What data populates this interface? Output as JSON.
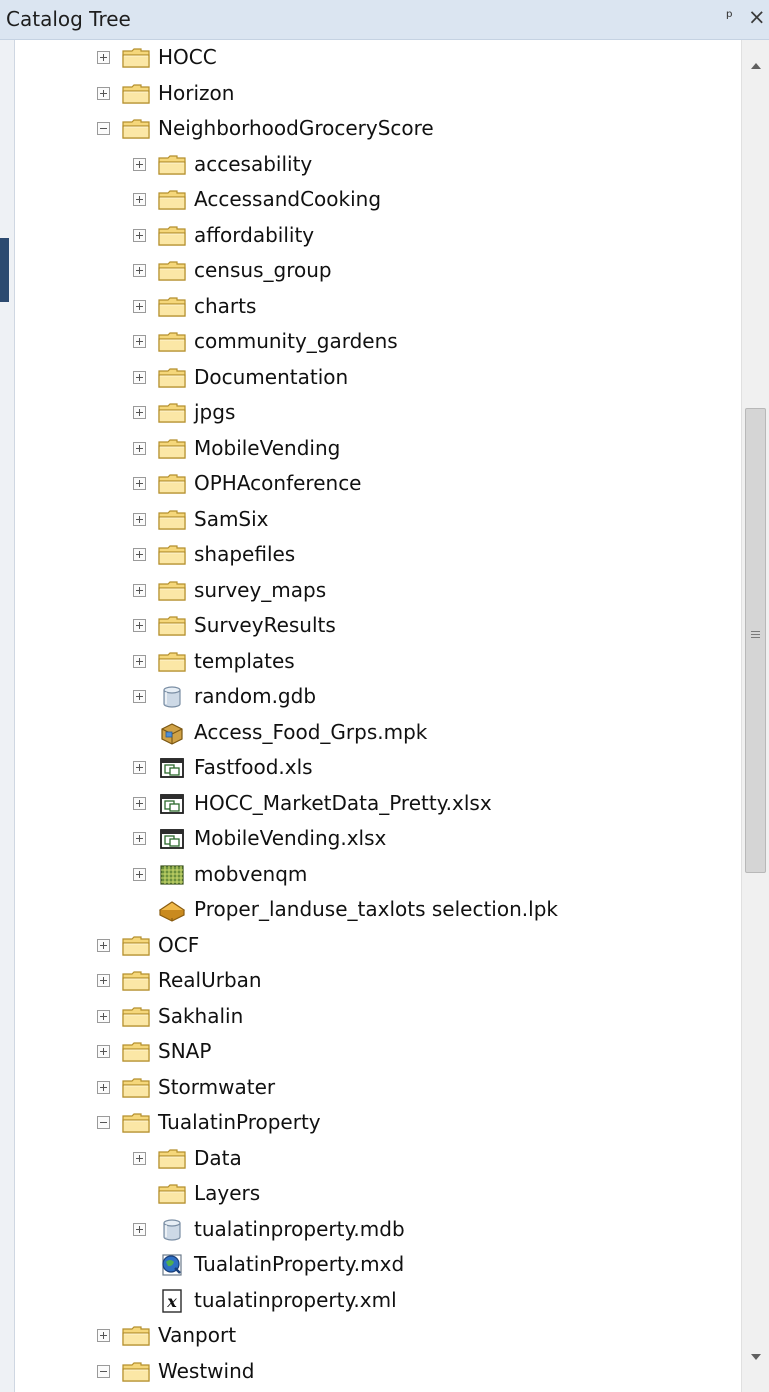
{
  "panel": {
    "title": "Catalog Tree",
    "pin_glyph": "ᵖ",
    "close_glyph": "×"
  },
  "tree": {
    "items": [
      {
        "level": 0,
        "expander": "plus",
        "icon": "folder-icon",
        "label": "HOCC"
      },
      {
        "level": 0,
        "expander": "plus",
        "icon": "folder-icon",
        "label": "Horizon"
      },
      {
        "level": 0,
        "expander": "minus",
        "icon": "folder-icon",
        "label": "NeighborhoodGroceryScore"
      },
      {
        "level": 1,
        "expander": "plus",
        "icon": "folder-icon",
        "label": "accesability"
      },
      {
        "level": 1,
        "expander": "plus",
        "icon": "folder-icon",
        "label": "AccessandCooking"
      },
      {
        "level": 1,
        "expander": "plus",
        "icon": "folder-icon",
        "label": "affordability"
      },
      {
        "level": 1,
        "expander": "plus",
        "icon": "folder-icon",
        "label": "census_group"
      },
      {
        "level": 1,
        "expander": "plus",
        "icon": "folder-icon",
        "label": "charts"
      },
      {
        "level": 1,
        "expander": "plus",
        "icon": "folder-icon",
        "label": "community_gardens"
      },
      {
        "level": 1,
        "expander": "plus",
        "icon": "folder-icon",
        "label": "Documentation"
      },
      {
        "level": 1,
        "expander": "plus",
        "icon": "folder-icon",
        "label": "jpgs"
      },
      {
        "level": 1,
        "expander": "plus",
        "icon": "folder-icon",
        "label": "MobileVending"
      },
      {
        "level": 1,
        "expander": "plus",
        "icon": "folder-icon",
        "label": "OPHAconference"
      },
      {
        "level": 1,
        "expander": "plus",
        "icon": "folder-icon",
        "label": "SamSix"
      },
      {
        "level": 1,
        "expander": "plus",
        "icon": "folder-icon",
        "label": "shapefiles"
      },
      {
        "level": 1,
        "expander": "plus",
        "icon": "folder-icon",
        "label": "survey_maps"
      },
      {
        "level": 1,
        "expander": "plus",
        "icon": "folder-icon",
        "label": "SurveyResults"
      },
      {
        "level": 1,
        "expander": "plus",
        "icon": "folder-icon",
        "label": "templates"
      },
      {
        "level": 1,
        "expander": "plus",
        "icon": "database-icon",
        "label": "random.gdb"
      },
      {
        "level": 1,
        "expander": "none",
        "icon": "map-package-icon",
        "label": "Access_Food_Grps.mpk"
      },
      {
        "level": 1,
        "expander": "plus",
        "icon": "table-icon",
        "label": "Fastfood.xls"
      },
      {
        "level": 1,
        "expander": "plus",
        "icon": "table-icon",
        "label": "HOCC_MarketData_Pretty.xlsx"
      },
      {
        "level": 1,
        "expander": "plus",
        "icon": "table-icon",
        "label": "MobileVending.xlsx"
      },
      {
        "level": 1,
        "expander": "plus",
        "icon": "raster-icon",
        "label": "mobvenqm"
      },
      {
        "level": 1,
        "expander": "none",
        "icon": "layer-package-icon",
        "label": "Proper_landuse_taxlots selection.lpk"
      },
      {
        "level": 0,
        "expander": "plus",
        "icon": "folder-icon",
        "label": "OCF"
      },
      {
        "level": 0,
        "expander": "plus",
        "icon": "folder-icon",
        "label": "RealUrban"
      },
      {
        "level": 0,
        "expander": "plus",
        "icon": "folder-icon",
        "label": "Sakhalin"
      },
      {
        "level": 0,
        "expander": "plus",
        "icon": "folder-icon",
        "label": "SNAP"
      },
      {
        "level": 0,
        "expander": "plus",
        "icon": "folder-icon",
        "label": "Stormwater"
      },
      {
        "level": 0,
        "expander": "minus",
        "icon": "folder-icon",
        "label": "TualatinProperty"
      },
      {
        "level": 1,
        "expander": "plus",
        "icon": "folder-icon",
        "label": "Data"
      },
      {
        "level": 1,
        "expander": "none",
        "icon": "folder-icon",
        "label": "Layers"
      },
      {
        "level": 1,
        "expander": "plus",
        "icon": "database-icon",
        "label": "tualatinproperty.mdb"
      },
      {
        "level": 1,
        "expander": "none",
        "icon": "map-document-icon",
        "label": "TualatinProperty.mxd"
      },
      {
        "level": 1,
        "expander": "none",
        "icon": "xml-icon",
        "label": "tualatinproperty.xml"
      },
      {
        "level": 0,
        "expander": "plus",
        "icon": "folder-icon",
        "label": "Vanport"
      },
      {
        "level": 0,
        "expander": "minus",
        "icon": "folder-icon",
        "label": "Westwind"
      }
    ]
  },
  "scrollbar": {
    "position": 0.52,
    "visible_fraction": 0.36
  }
}
